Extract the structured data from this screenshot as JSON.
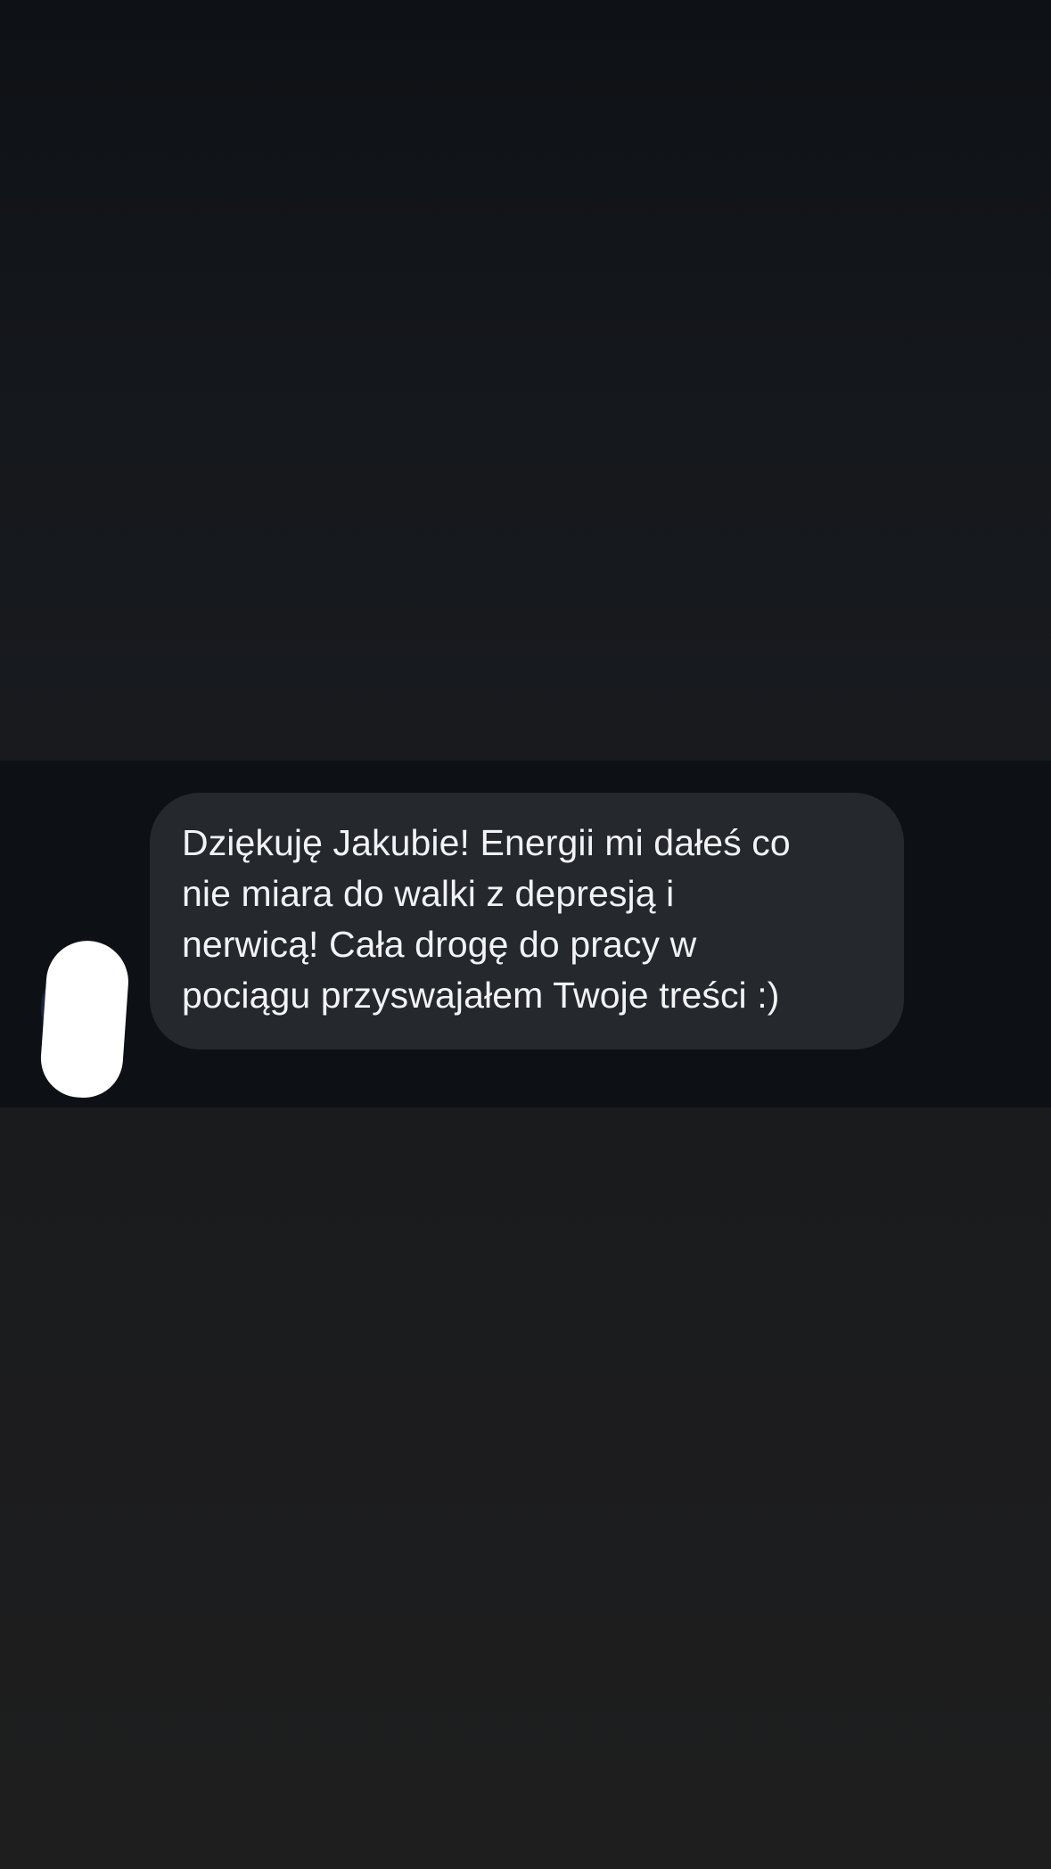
{
  "conversation": {
    "message": {
      "lines": [
        "Dziękuję Jakubie! Energii mi dałeś co",
        "nie miara do walki z depresją i",
        "nerwicą! Cała drogę do pracy w",
        "pociągu przyswajałem Twoje treści :)"
      ]
    }
  },
  "colors": {
    "background": "#0e1115",
    "bubble": "#25282d",
    "text": "#f2f3f5",
    "redaction": "#ffffff"
  }
}
